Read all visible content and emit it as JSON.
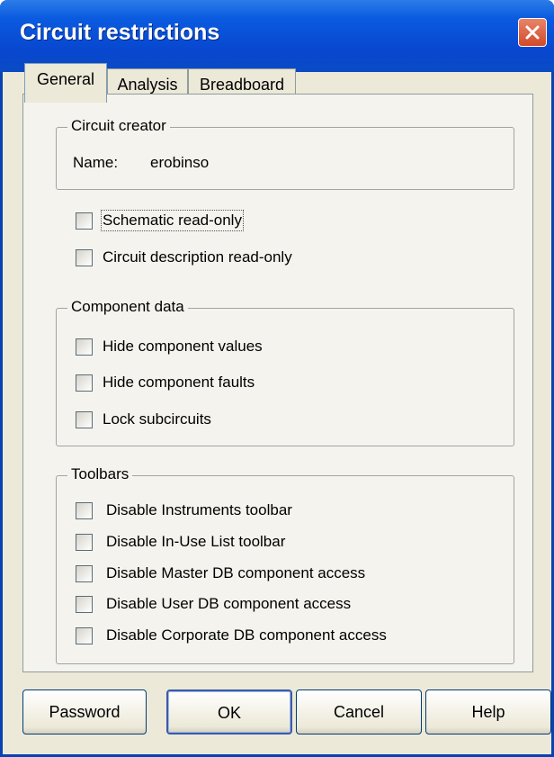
{
  "window": {
    "title": "Circuit restrictions"
  },
  "tabs": [
    {
      "label": "General",
      "active": true
    },
    {
      "label": "Analysis",
      "active": false
    },
    {
      "label": "Breadboard",
      "active": false
    }
  ],
  "circuit_creator": {
    "legend": "Circuit creator",
    "name_label": "Name:",
    "name_value": "erobinso"
  },
  "general_options": [
    {
      "label": "Schematic read-only",
      "checked": false
    },
    {
      "label": "Circuit description read-only",
      "checked": false
    }
  ],
  "component_data": {
    "legend": "Component data",
    "items": [
      {
        "label": "Hide component values",
        "checked": false
      },
      {
        "label": "Hide component faults",
        "checked": false
      },
      {
        "label": "Lock subcircuits",
        "checked": false
      }
    ]
  },
  "toolbars": {
    "legend": "Toolbars",
    "items": [
      {
        "label": "Disable Instruments toolbar",
        "checked": false
      },
      {
        "label": "Disable In-Use List toolbar",
        "checked": false
      },
      {
        "label": "Disable Master DB component access",
        "checked": false
      },
      {
        "label": "Disable User DB component access",
        "checked": false
      },
      {
        "label": "Disable Corporate DB component access",
        "checked": false
      }
    ]
  },
  "buttons": {
    "password": "Password",
    "ok": "OK",
    "cancel": "Cancel",
    "help": "Help"
  },
  "colors": {
    "titlebar": "#0a5be0",
    "dialog_bg": "#ece9d8",
    "close_button": "#d2492a"
  }
}
